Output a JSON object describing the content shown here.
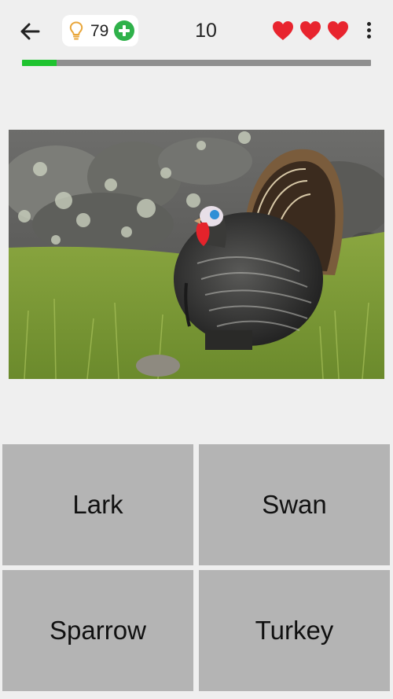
{
  "header": {
    "back_icon": "arrow-left-icon",
    "hints": {
      "icon": "lightbulb-icon",
      "count": "79",
      "add_icon": "plus-circle-icon",
      "add_color": "#2fb14a"
    },
    "question_number": "10",
    "lives": {
      "count": 3,
      "icon": "heart-icon",
      "color": "#e8242e"
    },
    "menu_icon": "more-vertical-icon"
  },
  "progress": {
    "fraction": 0.1,
    "fill_color": "#1fc32f",
    "track_color": "#8f8f8f"
  },
  "photo": {
    "subject": "turkey"
  },
  "answers": [
    "Lark",
    "Swan",
    "Sparrow",
    "Turkey"
  ]
}
